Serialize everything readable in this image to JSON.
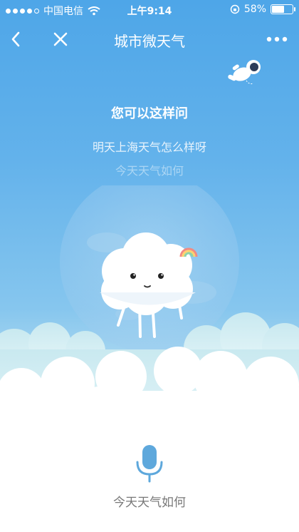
{
  "status_bar": {
    "carrier": "中国电信",
    "time": "上午9:14",
    "battery": "58%",
    "battery_level": 0.58
  },
  "nav": {
    "title": "城市微天气",
    "back_icon": "chevron-left-icon",
    "close_icon": "close-icon",
    "more_icon": "more-dots-icon"
  },
  "prompt": {
    "title": "您可以这样问",
    "suggestions": [
      "明天上海天气怎么样呀",
      "今天天气如何"
    ]
  },
  "voice": {
    "icon": "microphone-icon",
    "caption": "今天天气如何",
    "accent": "#5ea8dc"
  }
}
